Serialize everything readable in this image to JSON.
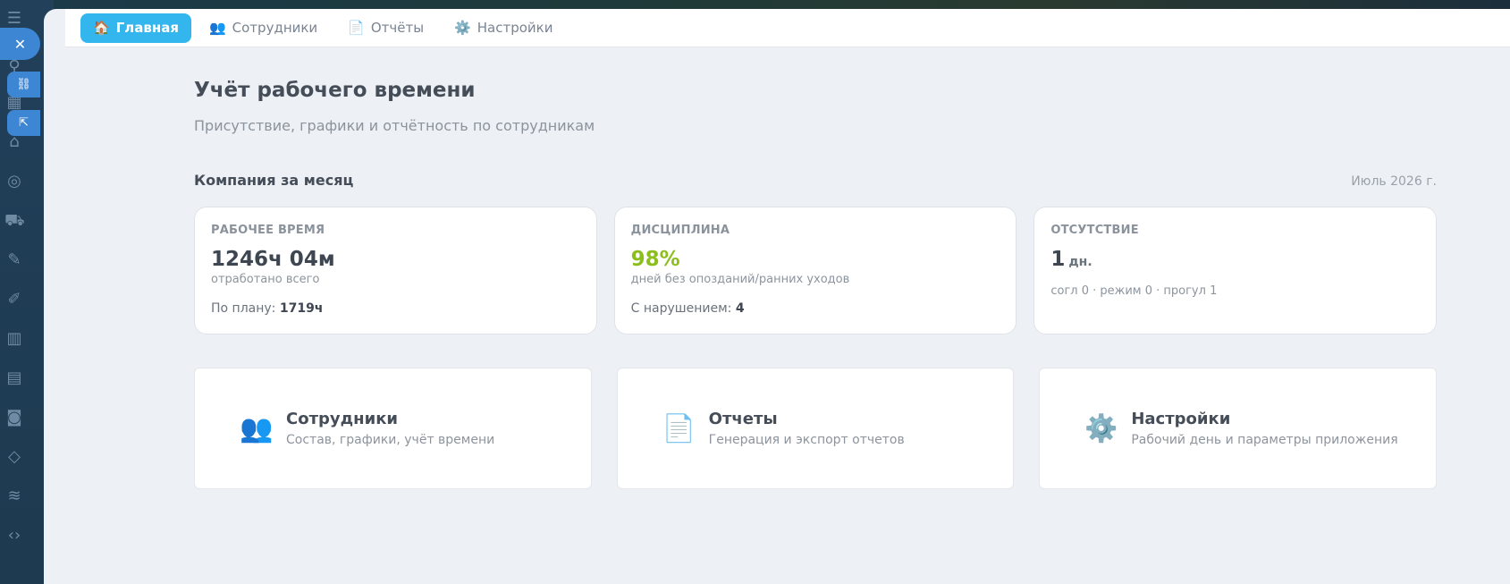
{
  "nav": {
    "items": [
      {
        "label": "Главная",
        "icon": "home-icon",
        "glyph": "🏠",
        "active": true
      },
      {
        "label": "Сотрудники",
        "icon": "people-icon",
        "glyph": "👥",
        "active": false
      },
      {
        "label": "Отчёты",
        "icon": "document-icon",
        "glyph": "📄",
        "active": false
      },
      {
        "label": "Настройки",
        "icon": "gear-icon",
        "glyph": "⚙️",
        "active": false
      }
    ]
  },
  "header": {
    "title": "Учёт рабочего времени",
    "subtitle": "Присутствие, графики и отчётность по сотрудникам"
  },
  "summary": {
    "section_title": "Компания за месяц",
    "period": "Июль 2026 г.",
    "cards": {
      "work": {
        "label": "РАБОЧЕЕ ВРЕМЯ",
        "value": "1246ч 04м",
        "desc": "отработано всего",
        "plan_label": "По плану:",
        "plan_value": "1719ч"
      },
      "discipline": {
        "label": "ДИСЦИПЛИНА",
        "value": "98%",
        "value_color": "#8cbf1e",
        "desc": "дней без опозданий/ранних уходов",
        "violations_label": "С нарушением:",
        "violations_value": "4"
      },
      "absence": {
        "label": "ОТСУТСТВИЕ",
        "value": "1",
        "unit": "дн.",
        "breakdown": "согл 0 · режим 0 · прогул 1"
      }
    }
  },
  "tiles": [
    {
      "title": "Сотрудники",
      "desc": "Состав, графики, учёт времени",
      "icon": "people-icon",
      "glyph": "👥"
    },
    {
      "title": "Отчеты",
      "desc": "Генерация и экспорт отчетов",
      "icon": "document-icon",
      "glyph": "📄"
    },
    {
      "title": "Настройки",
      "desc": "Рабочий день и параметры приложения",
      "icon": "gear-icon",
      "glyph": "⚙️"
    }
  ],
  "colors": {
    "accent": "#33b6ee",
    "background": "#edf0f4"
  }
}
